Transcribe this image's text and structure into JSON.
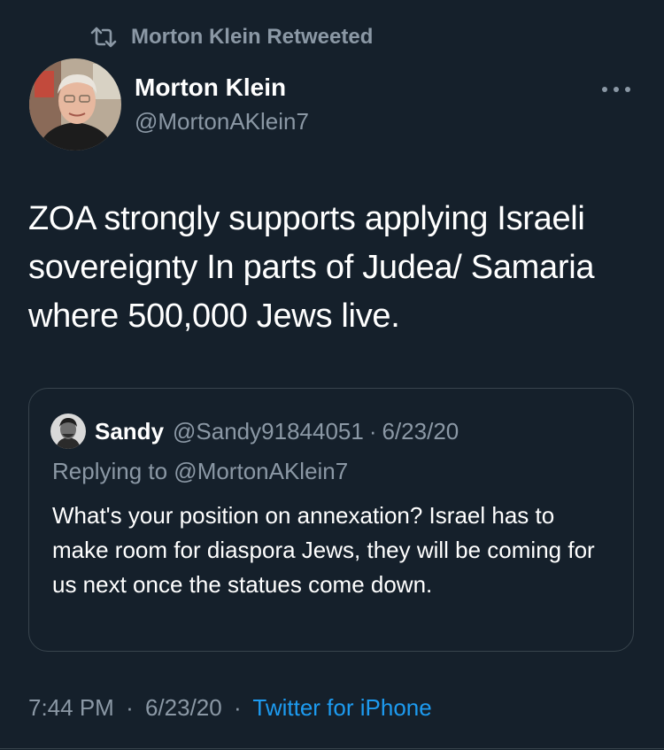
{
  "retweet": {
    "label": "Morton Klein Retweeted"
  },
  "author": {
    "name": "Morton Klein",
    "handle": "@MortonAKlein7"
  },
  "tweet": {
    "text": "ZOA strongly supports applying Israeli sovereignty In parts of Judea/ Samaria where 500,000 Jews live."
  },
  "quote": {
    "name": "Sandy",
    "handle": "@Sandy91844051",
    "dot": "·",
    "date": "6/23/20",
    "replying_to": "Replying to @MortonAKlein7",
    "text": "What's your position on annexation? Israel has to make room for diaspora Jews, they will be coming for us next once the statues come down."
  },
  "meta": {
    "time": "7:44 PM",
    "sep1": "·",
    "date": "6/23/20",
    "sep2": "·",
    "source": "Twitter for iPhone"
  },
  "colors": {
    "background": "#15202b",
    "secondary_text": "#8b98a5",
    "link": "#1d9bf0",
    "border": "#38444d"
  },
  "icons": {
    "retweet": "retweet-icon",
    "more": "more-icon"
  }
}
